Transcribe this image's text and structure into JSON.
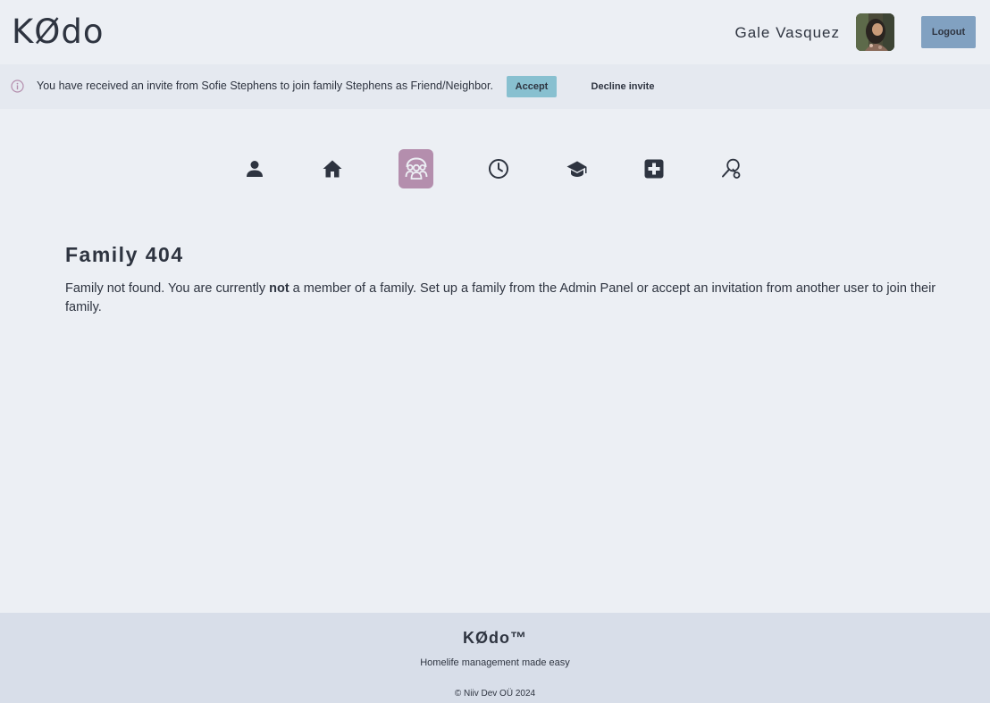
{
  "header": {
    "logo": "KØdo",
    "user_name": "Gale Vasquez",
    "logout_label": "Logout"
  },
  "alert": {
    "message": "You have received an invite from Sofie Stephens to join family Stephens as Friend/Neighbor.",
    "accept_label": "Accept",
    "decline_label": "Decline invite"
  },
  "nav": {
    "active": "family",
    "items": [
      {
        "icon": "person-icon"
      },
      {
        "icon": "home-icon"
      },
      {
        "icon": "family-icon"
      },
      {
        "icon": "clock-icon"
      },
      {
        "icon": "graduation-cap-icon"
      },
      {
        "icon": "medical-icon"
      },
      {
        "icon": "key-search-icon"
      }
    ]
  },
  "main": {
    "title": "Family 404",
    "desc_before": "Family not found. You are currently ",
    "desc_bold": "not",
    "desc_after": " a member of a family. Set up a family from the Admin Panel or accept an invitation from another user to join their family."
  },
  "footer": {
    "brand": "KØdo™",
    "tagline": "Homelife management made easy",
    "copyright": "© Niiv Dev OÜ 2024"
  },
  "colors": {
    "background": "#eceff4",
    "alert_bg": "#e5e9f0",
    "footer_bg": "#d8dee9",
    "accent_logout": "#81a1c1",
    "accent_accept": "#88c0d0",
    "active_nav": "#b48ead",
    "info_icon": "#b48ead",
    "text": "#2e3440"
  }
}
